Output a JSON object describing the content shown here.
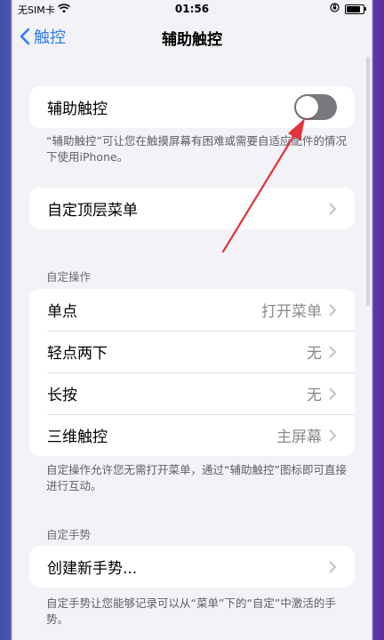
{
  "status_bar": {
    "carrier": "无SIM卡",
    "time": "01:56",
    "battery_percent": 82
  },
  "nav": {
    "back_label": "触控",
    "title": "辅助触控"
  },
  "toggle_group": {
    "label": "辅助触控",
    "enabled": false
  },
  "toggle_footnote": "“辅助触控”可让您在触摸屏幕有困难或需要自适应配件的情况下使用iPhone。",
  "top_menu": {
    "label": "自定顶层菜单"
  },
  "custom_actions": {
    "header": "自定操作",
    "rows": [
      {
        "label": "单点",
        "value": "打开菜单"
      },
      {
        "label": "轻点两下",
        "value": "无"
      },
      {
        "label": "长按",
        "value": "无"
      },
      {
        "label": "三维触控",
        "value": "主屏幕"
      }
    ],
    "footnote": "自定操作允许您无需打开菜单，通过“辅助触控”图标即可直接进行互动。"
  },
  "custom_gestures": {
    "header": "自定手势",
    "create_label": "创建新手势...",
    "footnote": "自定手势让您能够记录可以从“菜单”下的“自定”中激活的手势。"
  },
  "colors": {
    "accent": "#2f7cf6",
    "arrow": "#e5323a",
    "toggle_off": "#79797d"
  },
  "icons": [
    "wifi-icon",
    "orientation-lock-icon",
    "battery-icon",
    "chevron-left-icon",
    "chevron-right-icon",
    "annotation-arrow"
  ]
}
